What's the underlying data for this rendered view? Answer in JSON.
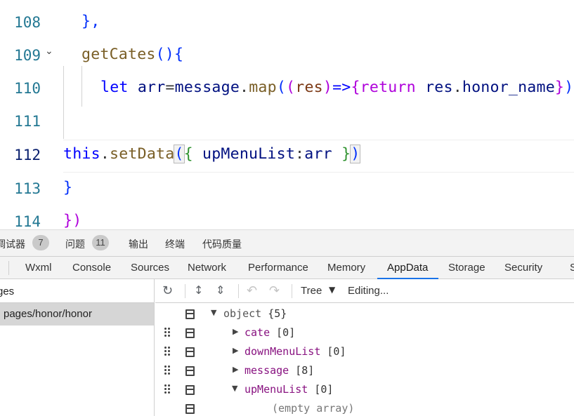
{
  "editor": {
    "lines": [
      {
        "n": "108",
        "c": "},"
      },
      {
        "n": "109",
        "c": "getCates(){"
      },
      {
        "n": "110",
        "let": "let",
        "arr": "arr",
        "eq": "=",
        "msg": "message",
        "dot": ".",
        "map": "map",
        "p1": "(",
        "p2": "(",
        "res": "res",
        "p3": ")",
        "arrow": "=>",
        "br": "{",
        "ret": "return",
        "res2": "res",
        "dot2": ".",
        "honor": "honor_name",
        "br2": "}",
        "p4": ")"
      },
      {
        "n": "111"
      },
      {
        "n": "112",
        "this": "this",
        "dot": ".",
        "setData": "setData",
        "p1": "(",
        "br": "{",
        "key": " upMenuList",
        "colon": ":",
        "val": "arr ",
        "br2": "}",
        "p2": ")"
      },
      {
        "n": "113",
        "c": "}"
      },
      {
        "n": "114",
        "c": "})"
      }
    ]
  },
  "panel_tabs": [
    {
      "label": "调试器",
      "badge": "7"
    },
    {
      "label": "问题",
      "badge": "11"
    },
    {
      "label": "输出"
    },
    {
      "label": "终端"
    },
    {
      "label": "代码质量"
    }
  ],
  "devtools_tabs": [
    "Wxml",
    "Console",
    "Sources",
    "Network",
    "Performance",
    "Memory",
    "AppData",
    "Storage",
    "Security",
    "S"
  ],
  "active_tab": "AppData",
  "sidebar": {
    "header": "ges",
    "item": "pages/honor/honor"
  },
  "toolbar": {
    "view_mode": "Tree",
    "status": "Editing...",
    "icons": [
      "refresh-icon",
      "expand-all-icon",
      "collapse-all-icon",
      "undo-icon",
      "redo-icon",
      "dropdown-icon"
    ]
  },
  "tree": [
    {
      "key": "object",
      "count": "{5}",
      "expanded": true
    },
    {
      "key": "cate",
      "count": "[0]"
    },
    {
      "key": "downMenuList",
      "count": "[0]"
    },
    {
      "key": "message",
      "count": "[8]"
    },
    {
      "key": "upMenuList",
      "count": "[0]",
      "expanded": true
    },
    {
      "empty": "(empty array)"
    }
  ],
  "colors": {
    "accent": "#1a73e8",
    "line_number": "#237893",
    "tree_key": "#881280"
  }
}
